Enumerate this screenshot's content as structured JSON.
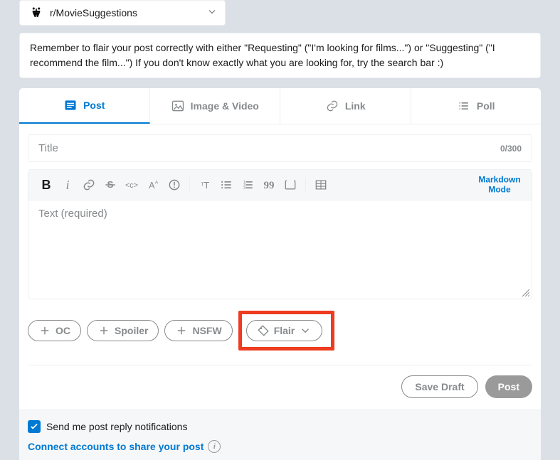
{
  "community": {
    "name": "r/MovieSuggestions"
  },
  "notice": "Remember to flair your post correctly with either \"Requesting\" (\"I'm looking for films...\") or \"Suggesting\" (\"I recommend the film...\") If you don't know exactly what you are looking for, try the search bar :)",
  "tabs": {
    "post": "Post",
    "image_video": "Image & Video",
    "link": "Link",
    "poll": "Poll"
  },
  "composer": {
    "title_placeholder": "Title",
    "title_counter": "0/300",
    "body_placeholder": "Text (required)",
    "markdown_line1": "Markdown",
    "markdown_line2": "Mode"
  },
  "tags": {
    "oc": "OC",
    "spoiler": "Spoiler",
    "nsfw": "NSFW",
    "flair": "Flair"
  },
  "actions": {
    "save_draft": "Save Draft",
    "post": "Post"
  },
  "footer": {
    "notif_label": "Send me post reply notifications",
    "connect_label": "Connect accounts to share your post"
  }
}
